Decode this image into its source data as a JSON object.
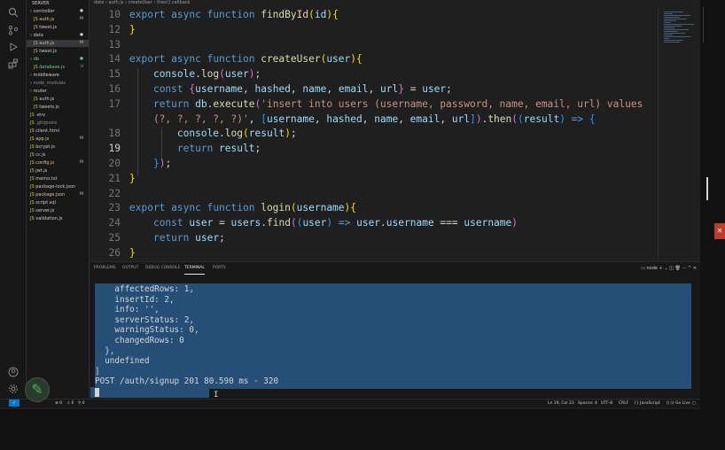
{
  "breadcrumb": [
    "data",
    "auth.js",
    "createUser",
    "then() callback"
  ],
  "explorer": {
    "title": "EXPLORER",
    "root": "SERVER",
    "items": [
      {
        "label": "controller",
        "badge": "●",
        "color": "#cccccc"
      },
      {
        "label": "auth.js",
        "badge": "M",
        "color": "#e2c08d"
      },
      {
        "label": "tweet.js",
        "badge": "",
        "color": "#cccccc"
      },
      {
        "label": "data",
        "badge": "●",
        "color": "#cccccc"
      },
      {
        "label": "auth.js",
        "badge": "M",
        "color": "#e2c08d"
      },
      {
        "label": "tweet.js",
        "badge": "",
        "color": "#cccccc"
      },
      {
        "label": "db",
        "badge": "●",
        "color": "#73c991"
      },
      {
        "label": "database.js",
        "badge": "U",
        "color": "#73c991"
      },
      {
        "label": "middleware",
        "badge": "",
        "color": "#cccccc"
      },
      {
        "label": "node_modules",
        "badge": "",
        "color": "#8c8c8c"
      },
      {
        "label": "router",
        "badge": "",
        "color": "#cccccc"
      },
      {
        "label": "auth.js",
        "badge": "",
        "color": "#cccccc"
      },
      {
        "label": "tweets.js",
        "badge": "",
        "color": "#cccccc"
      },
      {
        "label": ".env",
        "badge": "",
        "color": "#cccccc"
      },
      {
        "label": ".gitignore",
        "badge": "",
        "color": "#8c8c8c"
      },
      {
        "label": "client.html",
        "badge": "",
        "color": "#cccccc"
      },
      {
        "label": "app.js",
        "badge": "M",
        "color": "#e2c08d"
      },
      {
        "label": "bcrypt.js",
        "badge": "",
        "color": "#cccccc"
      },
      {
        "label": "cc.js",
        "badge": "",
        "color": "#cccccc"
      },
      {
        "label": "config.js",
        "badge": "M",
        "color": "#e2c08d"
      },
      {
        "label": "jwt.js",
        "badge": "",
        "color": "#cccccc"
      },
      {
        "label": "memo.txt",
        "badge": "",
        "color": "#cccccc"
      },
      {
        "label": "package-lock.json",
        "badge": "",
        "color": "#cccccc"
      },
      {
        "label": "package.json",
        "badge": "M",
        "color": "#e2c08d"
      },
      {
        "label": "script.sql",
        "badge": "",
        "color": "#cccccc"
      },
      {
        "label": "server.js",
        "badge": "",
        "color": "#cccccc"
      },
      {
        "label": "validation.js",
        "badge": "",
        "color": "#cccccc"
      }
    ]
  },
  "editor": {
    "current_line": 19,
    "lines": [
      {
        "n": "10",
        "tokens": [
          [
            "kw",
            "export "
          ],
          [
            "kw",
            "async "
          ],
          [
            "kw",
            "function "
          ],
          [
            "fn",
            "findById"
          ],
          [
            "br1",
            "("
          ],
          [
            "var",
            "id"
          ],
          [
            "br1",
            ")"
          ],
          [
            "br1",
            "{"
          ]
        ]
      },
      {
        "n": "12",
        "tokens": [
          [
            "br1",
            "}"
          ]
        ]
      },
      {
        "n": "13",
        "tokens": []
      },
      {
        "n": "14",
        "tokens": [
          [
            "kw",
            "export "
          ],
          [
            "kw",
            "async "
          ],
          [
            "kw",
            "function "
          ],
          [
            "fn",
            "createUser"
          ],
          [
            "br1",
            "("
          ],
          [
            "var",
            "user"
          ],
          [
            "br1",
            ")"
          ],
          [
            "br1",
            "{"
          ]
        ]
      },
      {
        "n": "15",
        "tokens": [
          [
            "pl",
            "    "
          ],
          [
            "var",
            "console"
          ],
          [
            "pl",
            "."
          ],
          [
            "fn",
            "log"
          ],
          [
            "br2",
            "("
          ],
          [
            "var",
            "user"
          ],
          [
            "br2",
            ")"
          ],
          [
            "pl",
            ";"
          ]
        ]
      },
      {
        "n": "16",
        "tokens": [
          [
            "pl",
            "    "
          ],
          [
            "kw",
            "const "
          ],
          [
            "br2",
            "{"
          ],
          [
            "var",
            "username"
          ],
          [
            "pl",
            ", "
          ],
          [
            "var",
            "hashed"
          ],
          [
            "pl",
            ", "
          ],
          [
            "var",
            "name"
          ],
          [
            "pl",
            ", "
          ],
          [
            "var",
            "email"
          ],
          [
            "pl",
            ", "
          ],
          [
            "var",
            "url"
          ],
          [
            "br2",
            "}"
          ],
          [
            "pl",
            " = "
          ],
          [
            "var",
            "user"
          ],
          [
            "pl",
            ";"
          ]
        ]
      },
      {
        "n": "17",
        "tokens": [
          [
            "pl",
            "    "
          ],
          [
            "kw",
            "return "
          ],
          [
            "var",
            "db"
          ],
          [
            "pl",
            "."
          ],
          [
            "fn",
            "execute"
          ],
          [
            "br2",
            "("
          ],
          [
            "str",
            "'insert into users (username, password, name, email, url) values"
          ]
        ]
      },
      {
        "n": "",
        "tokens": [
          [
            "str",
            "    (?, ?, ?, ?, ?)'"
          ],
          [
            "pl",
            ", "
          ],
          [
            "br3",
            "["
          ],
          [
            "var",
            "username"
          ],
          [
            "pl",
            ", "
          ],
          [
            "var",
            "hashed"
          ],
          [
            "pl",
            ", "
          ],
          [
            "var",
            "name"
          ],
          [
            "pl",
            ", "
          ],
          [
            "var",
            "email"
          ],
          [
            "pl",
            ", "
          ],
          [
            "var",
            "url"
          ],
          [
            "br3",
            "]"
          ],
          [
            "br2",
            ")"
          ],
          [
            "pl",
            "."
          ],
          [
            "fn",
            "then"
          ],
          [
            "br2",
            "("
          ],
          [
            "br3",
            "("
          ],
          [
            "var",
            "result"
          ],
          [
            "br3",
            ")"
          ],
          [
            "kw",
            " => "
          ],
          [
            "br3",
            "{"
          ]
        ]
      },
      {
        "n": "18",
        "tokens": [
          [
            "pl",
            "        "
          ],
          [
            "var",
            "console"
          ],
          [
            "pl",
            "."
          ],
          [
            "fn",
            "log"
          ],
          [
            "br1",
            "("
          ],
          [
            "var",
            "result"
          ],
          [
            "br1",
            ")"
          ],
          [
            "pl",
            ";"
          ]
        ]
      },
      {
        "n": "19",
        "tokens": [
          [
            "pl",
            "        "
          ],
          [
            "kw",
            "return "
          ],
          [
            "var",
            "result"
          ],
          [
            "pl",
            ";"
          ]
        ]
      },
      {
        "n": "20",
        "tokens": [
          [
            "pl",
            "    "
          ],
          [
            "br3",
            "}"
          ],
          [
            "br2",
            ")"
          ],
          [
            "pl",
            ";"
          ]
        ]
      },
      {
        "n": "21",
        "tokens": [
          [
            "br1",
            "}"
          ]
        ]
      },
      {
        "n": "22",
        "tokens": []
      },
      {
        "n": "23",
        "tokens": [
          [
            "kw",
            "export "
          ],
          [
            "kw",
            "async "
          ],
          [
            "kw",
            "function "
          ],
          [
            "fn",
            "login"
          ],
          [
            "br1",
            "("
          ],
          [
            "var",
            "username"
          ],
          [
            "br1",
            ")"
          ],
          [
            "br1",
            "{"
          ]
        ]
      },
      {
        "n": "24",
        "tokens": [
          [
            "pl",
            "    "
          ],
          [
            "kw",
            "const "
          ],
          [
            "var",
            "user"
          ],
          [
            "pl",
            " = "
          ],
          [
            "var",
            "users"
          ],
          [
            "pl",
            "."
          ],
          [
            "fn",
            "find"
          ],
          [
            "br2",
            "("
          ],
          [
            "br3",
            "("
          ],
          [
            "var",
            "user"
          ],
          [
            "br3",
            ")"
          ],
          [
            "kw",
            " => "
          ],
          [
            "var",
            "user"
          ],
          [
            "pl",
            "."
          ],
          [
            "var",
            "username"
          ],
          [
            "pl",
            " === "
          ],
          [
            "var",
            "username"
          ],
          [
            "br2",
            ")"
          ]
        ]
      },
      {
        "n": "25",
        "tokens": [
          [
            "pl",
            "    "
          ],
          [
            "kw",
            "return "
          ],
          [
            "var",
            "user"
          ],
          [
            "pl",
            ";"
          ]
        ]
      },
      {
        "n": "26",
        "tokens": [
          [
            "br1",
            "}"
          ]
        ]
      }
    ]
  },
  "panel": {
    "tabs": [
      "PROBLEMS",
      "OUTPUT",
      "DEBUG CONSOLE",
      "TERMINAL",
      "PORTS"
    ],
    "active_tab": "TERMINAL",
    "shell_label": "node",
    "terminal_lines": [
      "    affectedRows: 1,",
      "    insertId: 2,",
      "    info: '',",
      "    serverStatus: 2,",
      "    warningStatus: 0,",
      "    changedRows: 0",
      "  },",
      "  undefined",
      "]",
      "POST /auth/signup 201 80.590 ms - 320"
    ]
  },
  "statusbar": {
    "errors": "⊗ 0",
    "warnings": "⚠ 0",
    "ports": "⚲ 0",
    "position": "Ln 19, Col 23",
    "spaces": "Spaces: 4",
    "encoding": "UTF-8",
    "eol": "CRLF",
    "language": "{} JavaScript",
    "golive": "Go Live"
  },
  "colors": {
    "accent": "#0078d4",
    "selection": "#264f78",
    "modified": "#e2c08d",
    "untracked": "#73c991"
  }
}
